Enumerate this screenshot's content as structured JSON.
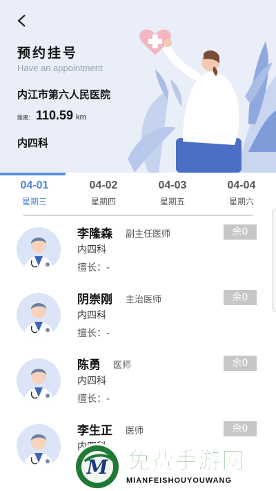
{
  "header": {
    "title": "预约挂号",
    "subtitle": "Have an appointment",
    "hospital": "内江市第六人民医院",
    "distance_label": "距离：",
    "distance_value": "110.59",
    "distance_unit": "km",
    "department": "内四科"
  },
  "tabs": [
    {
      "date": "04-01",
      "weekday": "星期三",
      "active": true
    },
    {
      "date": "04-02",
      "weekday": "星期四",
      "active": false
    },
    {
      "date": "04-03",
      "weekday": "星期五",
      "active": false
    },
    {
      "date": "04-04",
      "weekday": "星期六",
      "active": false
    }
  ],
  "doctors": [
    {
      "name": "李隆森",
      "rank": "副主任医师",
      "department": "内四科",
      "specialty": "擅长：-",
      "remaining": "余0"
    },
    {
      "name": "阴崇刚",
      "rank": "主治医师",
      "department": "内四科",
      "specialty": "擅长：-",
      "remaining": "余0"
    },
    {
      "name": "陈勇",
      "rank": "医师",
      "department": "内四科",
      "specialty": "擅长：-",
      "remaining": "余0"
    },
    {
      "name": "李生正",
      "rank": "医师",
      "department": "内四科",
      "specialty": "",
      "remaining": "余0"
    }
  ],
  "watermark": {
    "text": "免费手游网",
    "subtext": "MIANFEISHOUYOUWANG",
    "logo_letter": "M"
  },
  "colors": {
    "accent": "#4a86d8",
    "header_bg": "#e9eef8",
    "badge_bg": "#c7c7c7"
  },
  "icons": {
    "back": "chevron-left-icon",
    "avatar": "doctor-avatar-icon"
  }
}
